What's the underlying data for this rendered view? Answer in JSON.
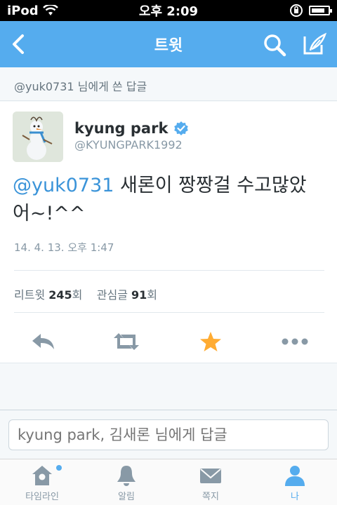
{
  "status_bar": {
    "carrier": "iPod",
    "time": "오후 2:09",
    "battery_level": 0.8
  },
  "nav": {
    "title": "트윗",
    "icons": [
      "back-icon",
      "search-icon",
      "compose-icon"
    ]
  },
  "reply_context": "@yuk0731 님에게 쓴 답글",
  "tweet": {
    "author_name": "kyung park",
    "author_handle": "@KYUNGPARK1992",
    "verified": true,
    "mention": "@yuk0731",
    "text": " 새론이 짱짱걸 수고많았어~!^^",
    "timestamp": "14. 4. 13. 오후 1:47",
    "retweets_label": "리트윗",
    "retweets_count": "245",
    "retweets_unit": "회",
    "favorites_label": "관심글",
    "favorites_count": "91",
    "favorites_unit": "회",
    "actions": [
      "reply-icon",
      "retweet-icon",
      "favorite-icon",
      "more-icon"
    ]
  },
  "reply_input": {
    "placeholder": "kyung park, 김새론 님에게 답글"
  },
  "tab_bar": {
    "tabs": [
      {
        "label": "타임라인",
        "icon": "home-icon",
        "active": false,
        "badge": true
      },
      {
        "label": "알림",
        "icon": "bell-icon",
        "active": false,
        "badge": false
      },
      {
        "label": "쪽지",
        "icon": "envelope-icon",
        "active": false,
        "badge": false
      },
      {
        "label": "나",
        "icon": "person-icon",
        "active": true,
        "badge": false
      }
    ]
  },
  "colors": {
    "brand": "#55acee",
    "mention": "#3b94d9",
    "favorite": "#ffac33",
    "muted": "#8899a6"
  }
}
